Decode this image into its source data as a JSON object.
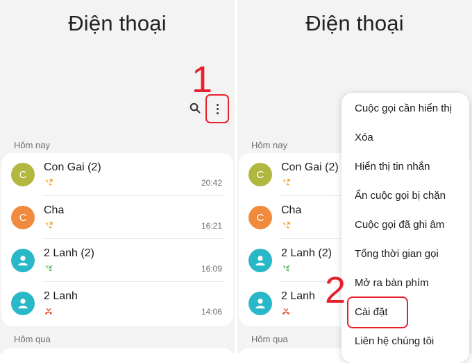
{
  "app_title": "Điện thoại",
  "sections": {
    "today": "Hôm nay",
    "yesterday": "Hôm qua"
  },
  "calls": [
    {
      "name": "Con Gai (2)",
      "time": "20:42",
      "avatar_letter": "C",
      "avatar_color": "#b1b73f",
      "call_type": "outgoing",
      "call_icon": "outgoing-call-icon"
    },
    {
      "name": "Cha",
      "time": "16:21",
      "avatar_letter": "C",
      "avatar_color": "#f08a3c",
      "call_type": "outgoing",
      "call_icon": "outgoing-call-icon"
    },
    {
      "name": "2 Lanh (2)",
      "time": "16:09",
      "avatar_letter": "",
      "avatar_color": "#29b8c8",
      "call_type": "incoming",
      "call_icon": "incoming-call-icon"
    },
    {
      "name": "2 Lanh",
      "time": "14:06",
      "avatar_letter": "",
      "avatar_color": "#29b8c8",
      "call_type": "missed",
      "call_icon": "missed-call-icon"
    }
  ],
  "step_labels": [
    "1",
    "2"
  ],
  "menu": [
    "Cuộc gọi cần hiển thị",
    "Xóa",
    "Hiển thị tin nhắn",
    "Ẩn cuộc gọi bị chặn",
    "Cuộc gọi đã ghi âm",
    "Tổng thời gian gọi",
    "Mở ra bàn phím",
    "Cài đặt",
    "Liên hệ chúng tôi"
  ],
  "colors": {
    "accent_red": "#e8202e",
    "outgoing": "#f0a030",
    "incoming": "#5cb85c",
    "missed": "#e8402e",
    "background": "#f3f3f3"
  },
  "icons": {
    "search": "search-icon",
    "more": "more-options-icon",
    "person": "person-icon"
  }
}
